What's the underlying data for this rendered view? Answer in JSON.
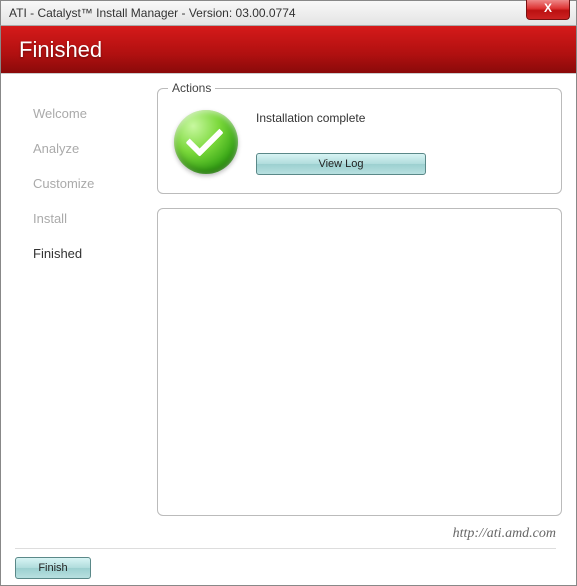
{
  "titlebar": {
    "text": "ATI - Catalyst™ Install Manager - Version: 03.00.0774",
    "close": "X"
  },
  "header": {
    "title": "Finished"
  },
  "sidebar": {
    "items": [
      {
        "label": "Welcome",
        "active": false
      },
      {
        "label": "Analyze",
        "active": false
      },
      {
        "label": "Customize",
        "active": false
      },
      {
        "label": "Install",
        "active": false
      },
      {
        "label": "Finished",
        "active": true
      }
    ]
  },
  "actions": {
    "legend": "Actions",
    "status": "Installation complete",
    "view_log": "View Log"
  },
  "footer": {
    "url": "http://ati.amd.com",
    "finish": "Finish"
  }
}
